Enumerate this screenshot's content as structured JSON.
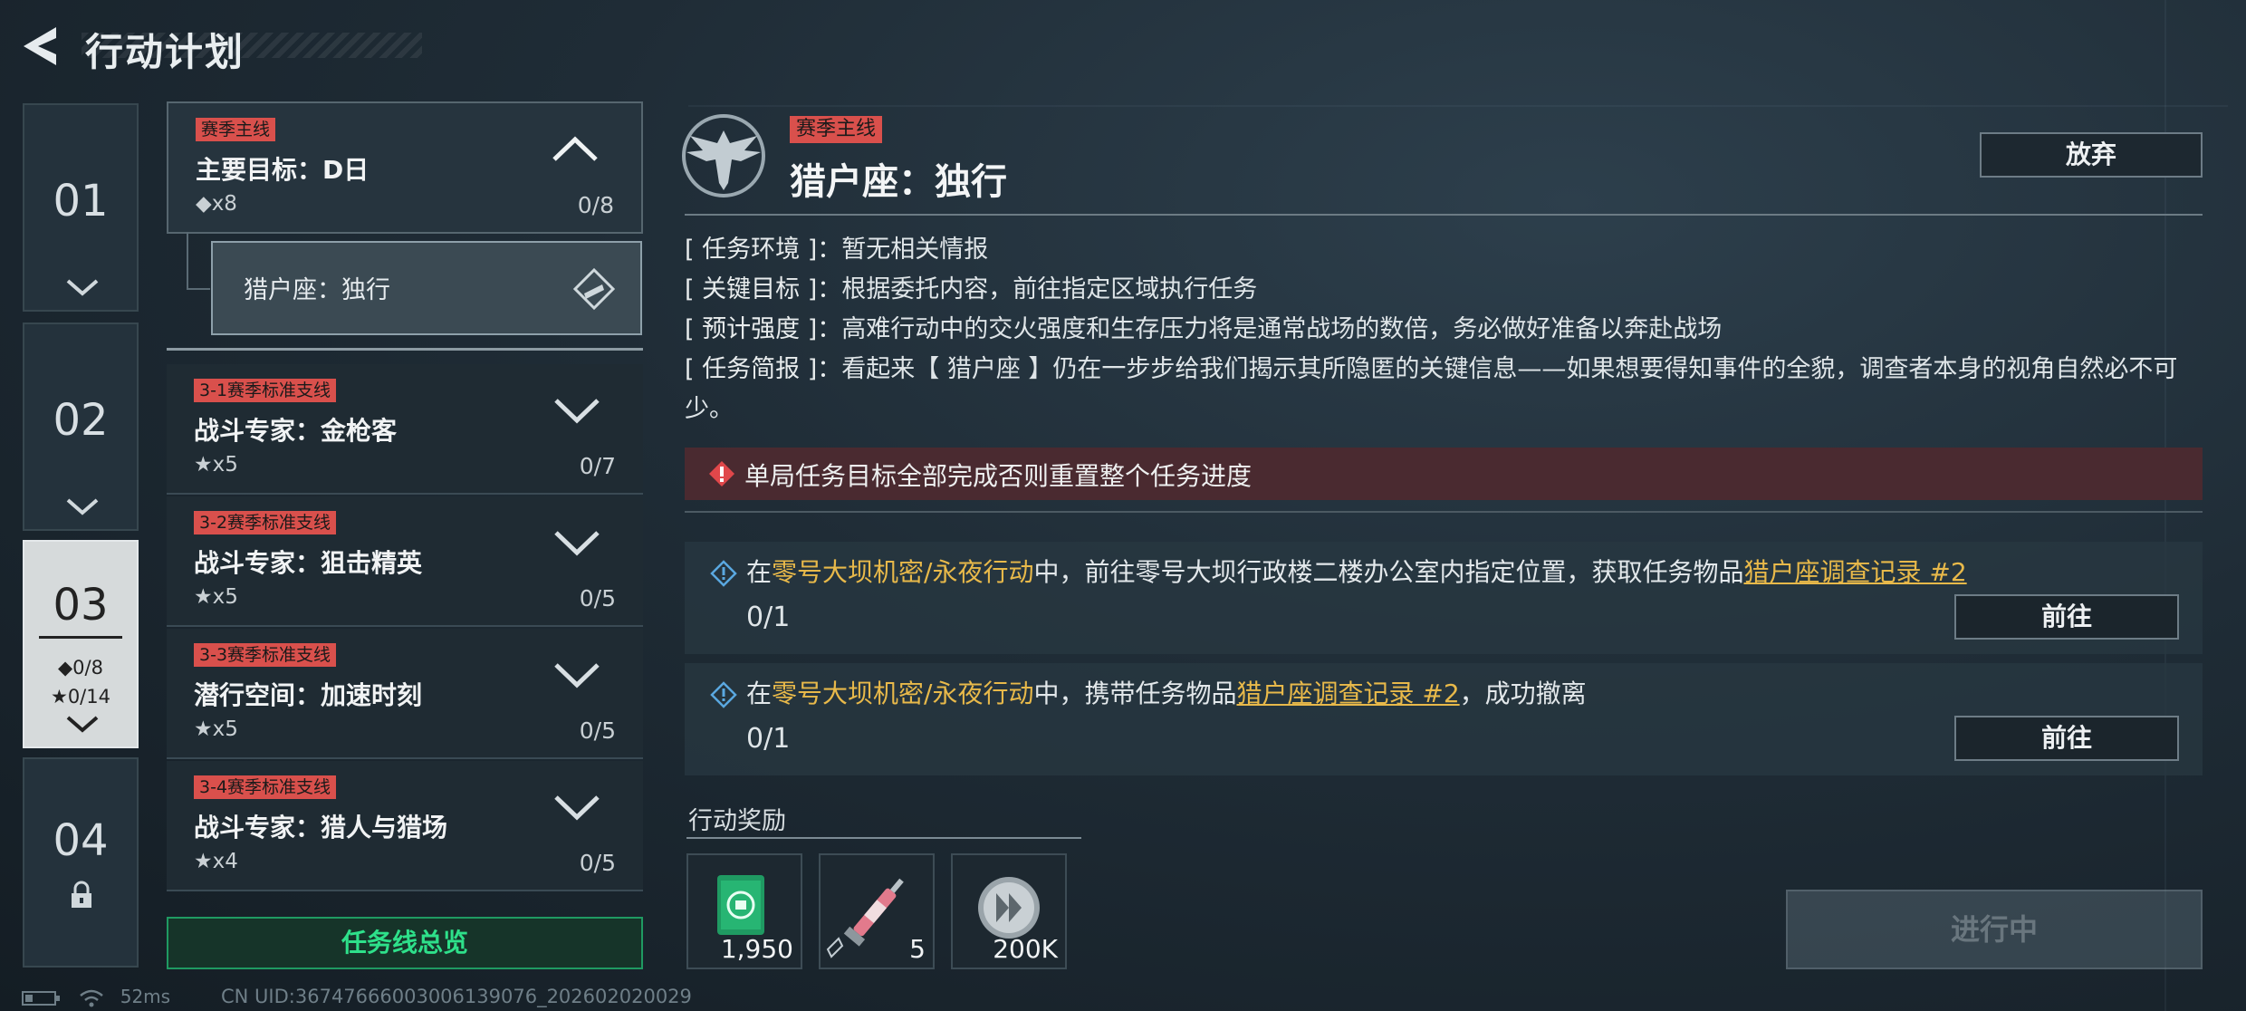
{
  "header": {
    "title": "行动计划"
  },
  "chapters": [
    {
      "num": "01"
    },
    {
      "num": "02"
    },
    {
      "num": "03",
      "stat_diamond": "◆0/8",
      "stat_star": "★0/14"
    },
    {
      "num": "04"
    }
  ],
  "quests": {
    "main": {
      "tag": "赛季主线",
      "title": "主要目标：D日",
      "count": "◆x8",
      "progress": "0/8"
    },
    "sub": {
      "label": "猎户座：独行"
    },
    "side": [
      {
        "tag": "3-1赛季标准支线",
        "title": "战斗专家：金枪客",
        "count": "★x5",
        "progress": "0/7"
      },
      {
        "tag": "3-2赛季标准支线",
        "title": "战斗专家：狙击精英",
        "count": "★x5",
        "progress": "0/5"
      },
      {
        "tag": "3-3赛季标准支线",
        "title": "潜行空间：加速时刻",
        "count": "★x5",
        "progress": "0/5"
      },
      {
        "tag": "3-4赛季标准支线",
        "title": "战斗专家：猎人与猎场",
        "count": "★x4",
        "progress": "0/5"
      }
    ],
    "overview_label": "任务线总览"
  },
  "detail": {
    "tag": "赛季主线",
    "title": "猎户座：独行",
    "abandon_label": "放弃",
    "info": [
      {
        "key": "[ 任务环境 ]：",
        "value": "暂无相关情报"
      },
      {
        "key": "[ 关键目标 ]：",
        "value": "根据委托内容，前往指定区域执行任务"
      },
      {
        "key": "[ 预计强度 ]：",
        "value": "高难行动中的交火强度和生存压力将是通常战场的数倍，务必做好准备以奔赴战场"
      },
      {
        "key": "[ 任务简报 ]：",
        "value": "看起来【 猎户座 】仍在一步步给我们揭示其所隐匿的关键信息——如果想要得知事件的全貌，调查者本身的视角自然必不可少。"
      }
    ],
    "warning": "单局任务目标全部完成否则重置整个任务进度",
    "tasks": [
      {
        "t1": "在",
        "map": "零号大坝机密/永夜行动",
        "t2": "中，前往零号大坝行政楼二楼办公室内指定位置，获取任务物品",
        "item": "猎户座调查记录 #2",
        "t3": "",
        "progress": "0/1",
        "button": "前往"
      },
      {
        "t1": "在",
        "map": "零号大坝机密/永夜行动",
        "t2": "中，携带任务物品",
        "item": "猎户座调查记录 #2",
        "t3": "，成功撤离",
        "progress": "0/1",
        "button": "前往"
      }
    ],
    "reward_label": "行动奖励",
    "rewards": [
      {
        "icon": "green-crate-icon",
        "value": "1,950"
      },
      {
        "icon": "syringe-icon",
        "value": "5"
      },
      {
        "icon": "silver-coin-icon",
        "value": "200K"
      }
    ],
    "status_button": "进行中"
  },
  "footer": {
    "ping": "52ms",
    "uid": "CN UID:3674766600300613907​6_202602020029"
  },
  "colors": {
    "tag_red": "#d9504c",
    "accent_green": "#2ee08a",
    "highlight_yellow": "#e8b94a",
    "warning_bg": "#4a2a30"
  }
}
